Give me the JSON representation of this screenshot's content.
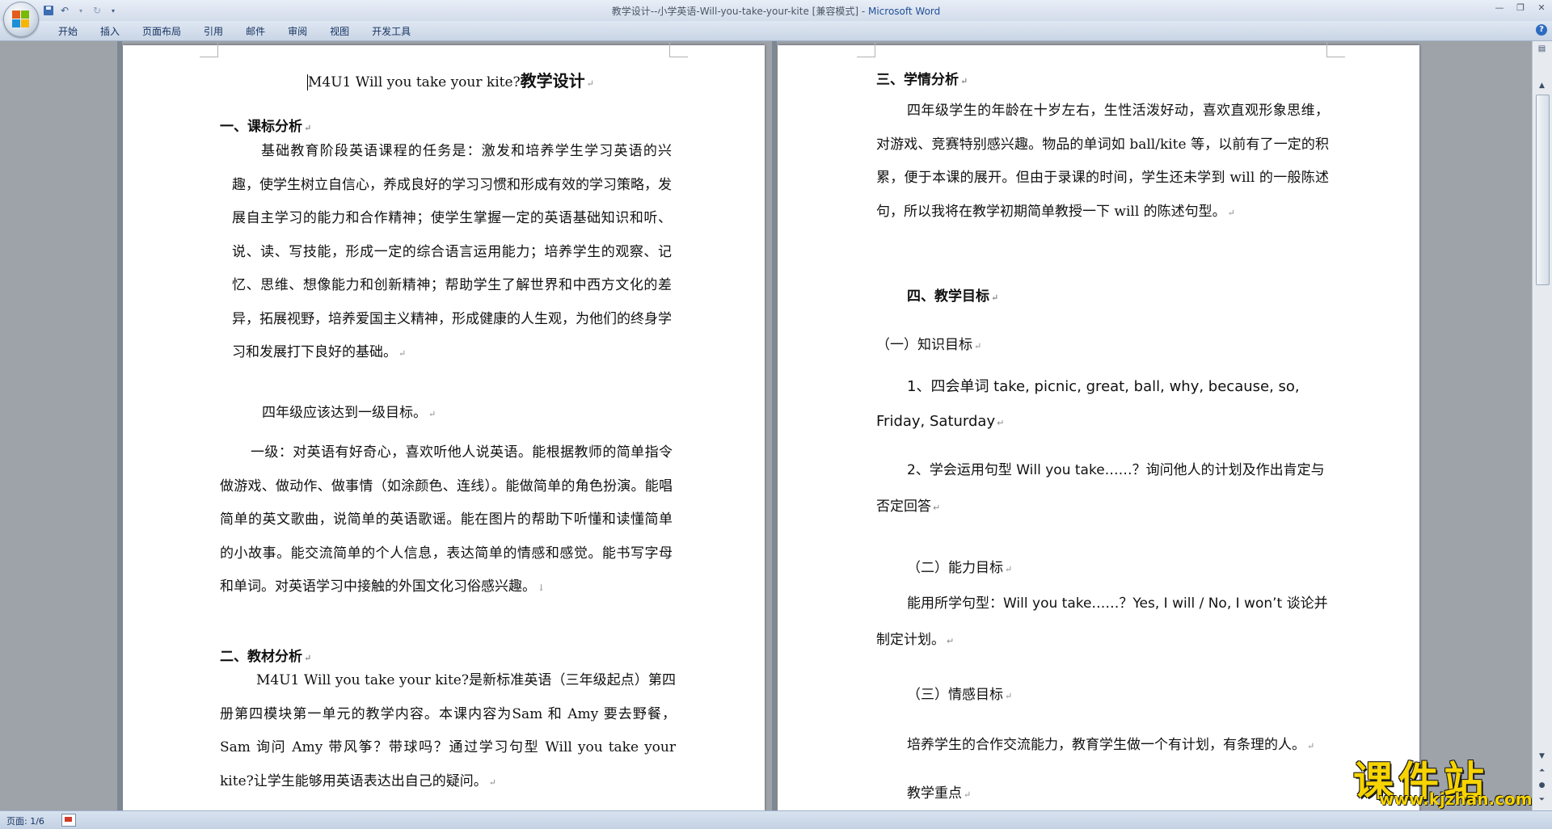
{
  "window": {
    "title_doc": "教学设计--小学英语-Will-you-take-your-kite [兼容模式]",
    "title_sep": " - ",
    "title_app": "Microsoft Word",
    "controls": [
      "—",
      "❐",
      "✕"
    ]
  },
  "ribbon": {
    "tabs": [
      "开始",
      "插入",
      "页面布局",
      "引用",
      "邮件",
      "审阅",
      "视图",
      "开发工具"
    ]
  },
  "status": {
    "page": "页面: 1/6"
  },
  "page_left": {
    "title_en": "M4U1 Will you take your kite?",
    "title_cn": "教学设计",
    "h1": "一、课标分析",
    "p1": "基础教育阶段英语课程的任务是：激发和培养学生学习英语的兴趣，使学生树立自信心，养成良好的学习习惯和形成有效的学习策略，发展自主学习的能力和合作精神；使学生掌握一定的英语基础知识和听、说、读、写技能，形成一定的综合语言运用能力；培养学生的观察、记忆、思维、想像能力和创新精神；帮助学生了解世界和中西方文化的差异，拓展视野，培养爱国主义精神，形成健康的人生观，为他们的终身学习和发展打下良好的基础。",
    "p2": "四年级应该达到一级目标。",
    "p3": "一级：对英语有好奇心，喜欢听他人说英语。能根据教师的简单指令做游戏、做动作、做事情（如涂颜色、连线）。能做简单的角色扮演。能唱简单的英文歌曲，说简单的英语歌谣。能在图片的帮助下听懂和读懂简单的小故事。能交流简单的个人信息，表达简单的情感和感觉。能书写字母和单词。对英语学习中接触的外国文化习俗感兴趣。",
    "h2": "二、教材分析",
    "p4": "M4U1 Will you take your kite?是新标准英语（三年级起点）第四册第四模块第一单元的教学内容。本课内容为Sam  和 Amy 要去野餐，Sam 询问 Amy 带风筝？带球吗？通过学习句型 Will you take your kite?让学生能够用英语表达出自己的疑问。"
  },
  "page_right": {
    "h3": "三、学情分析",
    "p5": "四年级学生的年龄在十岁左右，生性活泼好动，喜欢直观形象思维，对游戏、竞赛特别感兴趣。物品的单词如 ball/kite 等，以前有了一定的积累，便于本课的展开。但由于录课的时间，学生还未学到 will 的一般陈述句，所以我将在教学初期简单教授一下 will 的陈述句型。",
    "h4": "四、教学目标",
    "sub1": "（一）知识目标",
    "item1": "1、四会单词 take, picnic, great, ball, why, because, so, Friday, Saturday",
    "item2": "2、学会运用句型 Will you take……？询问他人的计划及作出肯定与否定回答",
    "sub2": "（二）能力目标",
    "ability": "能用所学句型：Will you take……？Yes, I will / No, I won’t 谈论并制定计划。",
    "sub3": "（三）情感目标",
    "emotion": "培养学生的合作交流能力，教育学生做一个有计划，有条理的人。",
    "key": "教学重点"
  },
  "marks": {
    "para": "↵",
    "line": "↓"
  },
  "watermark": {
    "cn": "课件站",
    "url": "www.kjzhan.com"
  }
}
